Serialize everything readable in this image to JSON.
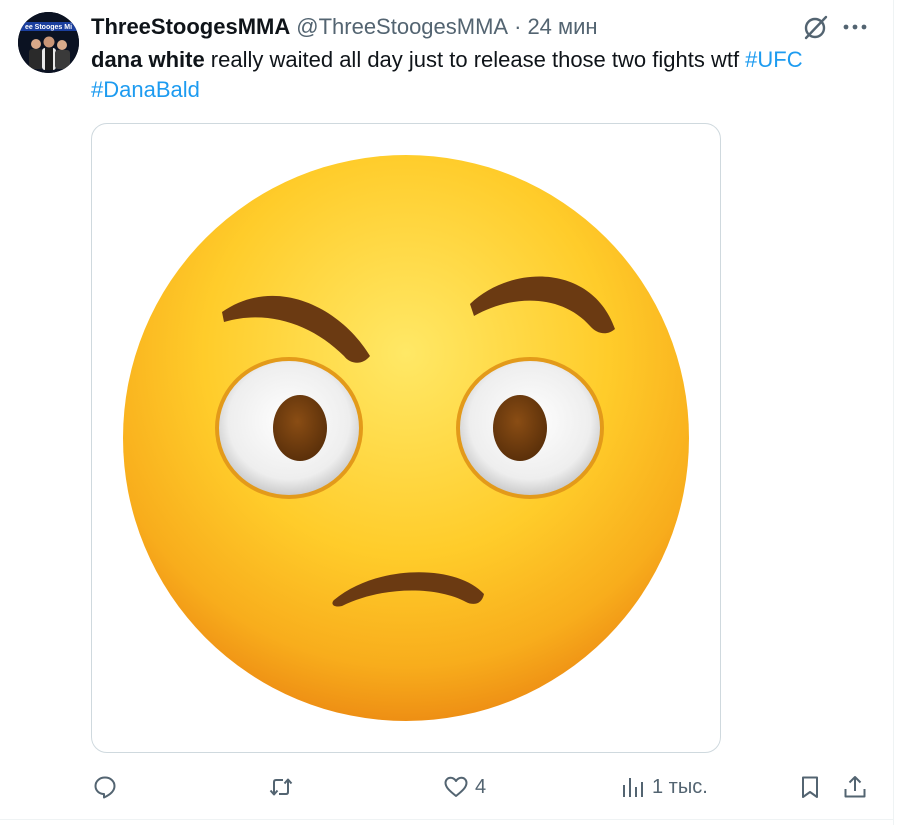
{
  "tweet": {
    "author_name": "ThreeStoogesMMA",
    "handle": "@ThreeStoogesMMA",
    "separator": "·",
    "time": "24 мин",
    "avatar_banner_text": "ee Stooges Mi",
    "text": {
      "mention": "dana white",
      "body": " really waited all day just to release those two fights wtf ",
      "hashtag1": "#UFC",
      "hashtag2": "#DanaBald"
    },
    "media": {
      "kind": "emoji image",
      "emoji": "face with raised eyebrow"
    }
  },
  "actions": {
    "reply_count": "",
    "retweet_count": "",
    "like_count": "4",
    "views_count": "1 тыс.",
    "bookmark_count": "",
    "share_count": ""
  },
  "icons": {
    "grok": "grok-icon",
    "more": "more-icon",
    "reply": "reply-icon",
    "retweet": "retweet-icon",
    "like": "heart-icon",
    "views": "views-icon",
    "bookmark": "bookmark-icon",
    "share": "share-icon"
  },
  "colors": {
    "text": "#0f1419",
    "secondary": "#536471",
    "link": "#1d9bf0",
    "border": "#cfd9de",
    "emoji_yellow": "#ffd232",
    "emoji_orange": "#f6a21a",
    "emoji_brown": "#6b3a12"
  }
}
